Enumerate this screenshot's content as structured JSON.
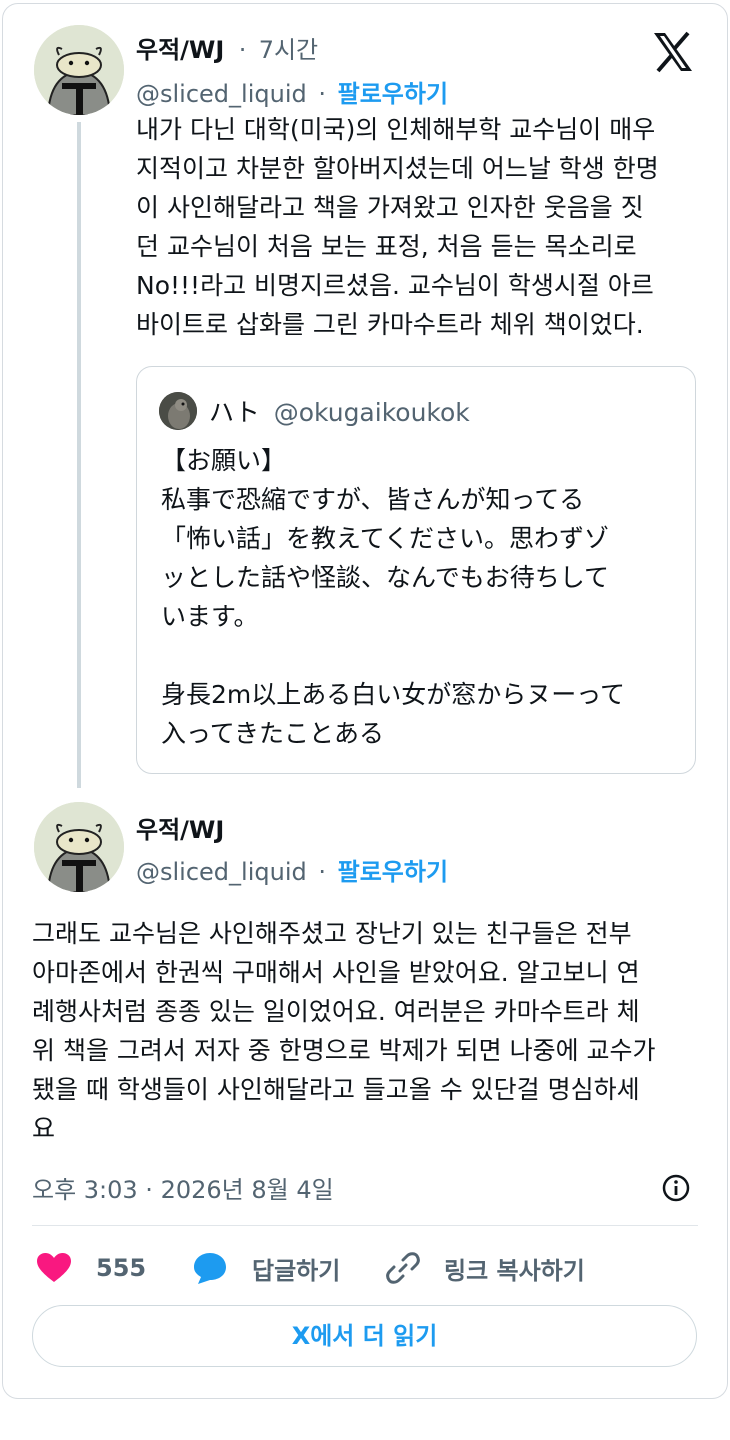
{
  "tweet1": {
    "name": "우적/WJ",
    "time": "7시간",
    "handle": "@sliced_liquid",
    "follow": "팔로우하기",
    "text": "내가 다닌 대학(미국)의 인체해부학 교수님이 매우\n지적이고 차분한 할아버지셨는데 어느날 학생 한명\n이 사인해달라고 책을 가져왔고 인자한 웃음을 짓\n던 교수님이 처음 보는 표정, 처음 듣는 목소리로\nNo!!!라고 비명지르셨음. 교수님이 학생시절 아르\n바이트로 삽화를 그린 카마수트라 체위 책이었다."
  },
  "quote": {
    "name": "ハト",
    "handle": "@okugaikoukok",
    "text": "【お願い】\n私事で恐縮ですが、皆さんが知ってる\n「怖い話」を教えてください。思わずゾ\nッとした話や怪談、なんでもお待ちして\nいます。\n\n身長2m以上ある白い女が窓からヌーって\n入ってきたことある"
  },
  "tweet2": {
    "name": "우적/WJ",
    "handle": "@sliced_liquid",
    "follow": "팔로우하기",
    "text": "그래도 교수님은 사인해주셨고 장난기 있는 친구들은 전부\n아마존에서 한권씩 구매해서 사인을 받았어요. 알고보니 연\n례행사처럼 종종 있는 일이었어요. 여러분은 카마수트라 체\n위 책을 그려서 저자 중 한명으로 박제가 되면 나중에 교수가\n됐을 때 학생들이 사인해달라고 들고올 수 있단걸 명심하세\n요",
    "timestamp": "오후 3:03 · 2026년 8월 4일"
  },
  "actions": {
    "likes": "555",
    "reply": "답글하기",
    "copy_link": "링크 복사하기"
  },
  "read_more": "X에서 더 읽기",
  "separator": "·",
  "colors": {
    "accent": "#1d9bf0",
    "like": "#f91880",
    "muted": "#536471"
  },
  "icons": [
    "x-logo-icon",
    "info-icon",
    "heart-icon",
    "reply-bubble-icon",
    "link-icon"
  ]
}
